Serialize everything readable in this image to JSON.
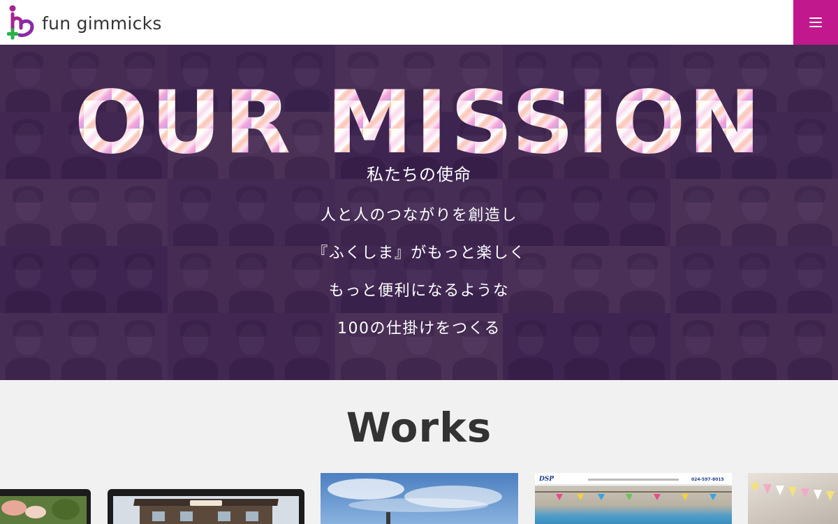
{
  "header": {
    "logo_text": "fun gimmicks",
    "brand_color": "#c1188e",
    "menu_icon": "hamburger-icon"
  },
  "hero": {
    "title": "OUR MISSION",
    "subtitle": "私たちの使命",
    "lines": [
      "人と人のつながりを創造し",
      "『ふくしま』がもっと楽しく",
      "もっと便利になるような",
      "100の仕掛けをつくる"
    ]
  },
  "works": {
    "title": "Works",
    "thumbnails": [
      {
        "name": "work-thumb-food"
      },
      {
        "name": "work-thumb-building"
      },
      {
        "name": "work-thumb-sky"
      },
      {
        "name": "work-thumb-pool",
        "site_tel": "024-597-8015",
        "site_logo": "DSP"
      },
      {
        "name": "work-thumb-flags"
      }
    ]
  }
}
